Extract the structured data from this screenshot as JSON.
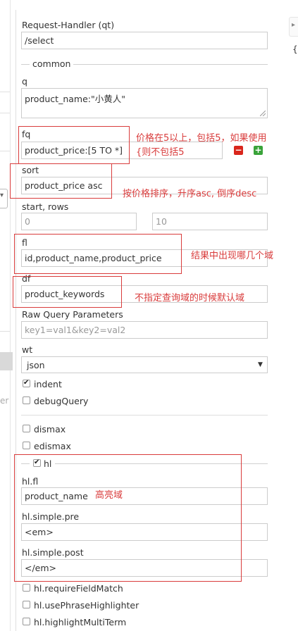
{
  "form": {
    "request_handler": {
      "label": "Request-Handler (qt)",
      "value": "/select"
    },
    "common_title": "common",
    "q": {
      "label": "q",
      "value": "product_name:\"小黄人\""
    },
    "fq": {
      "label": "fq",
      "value": "product_price:[5 TO *]"
    },
    "sort": {
      "label": "sort",
      "value": "product_price asc"
    },
    "start_rows": {
      "label": "start, rows",
      "start": "0",
      "rows": "10"
    },
    "fl": {
      "label": "fl",
      "value": "id,product_name,product_price"
    },
    "df": {
      "label": "df",
      "value": "product_keywords"
    },
    "raw_query": {
      "label": "Raw Query Parameters",
      "placeholder": "key1=val1&key2=val2"
    },
    "wt": {
      "label": "wt",
      "value": "json"
    },
    "indent": {
      "label": "indent",
      "checked": true
    },
    "debug_query": {
      "label": "debugQuery",
      "checked": false
    },
    "dismax": {
      "label": "dismax",
      "checked": false
    },
    "edismax": {
      "label": "edismax",
      "checked": false
    },
    "hl": {
      "label": "hl",
      "checked": true
    },
    "hl_fl": {
      "label": "hl.fl",
      "value": "product_name"
    },
    "hl_pre": {
      "label": "hl.simple.pre",
      "value": "<em>"
    },
    "hl_post": {
      "label": "hl.simple.post",
      "value": "</em>"
    },
    "hl_require": {
      "label": "hl.requireFieldMatch",
      "checked": false
    },
    "hl_phrase": {
      "label": "hl.usePhraseHighlighter",
      "checked": false
    },
    "hl_multi": {
      "label": "hl.highlightMultiTerm",
      "checked": false
    }
  },
  "annotations": {
    "fq_line1": "价格在5以上，包括5，如果使用",
    "fq_line2": "{则不包括5",
    "sort": "按价格排序，升序asc, 倒序desc",
    "fl": "结果中出现哪几个域",
    "df": "不指定查询域的时候默认域",
    "hl_fl": "高亮域"
  },
  "side": {
    "left_partial_text": "er",
    "right_brace": "{"
  },
  "colors": {
    "annotation_red": "#d93c3c",
    "remove_button": "#d9261c",
    "add_button": "#3aa33a"
  },
  "icons": {
    "remove_button": "minus-icon",
    "add_button": "plus-icon",
    "select": "chevron-down-icon",
    "checkbox": "checkmark-icon"
  }
}
